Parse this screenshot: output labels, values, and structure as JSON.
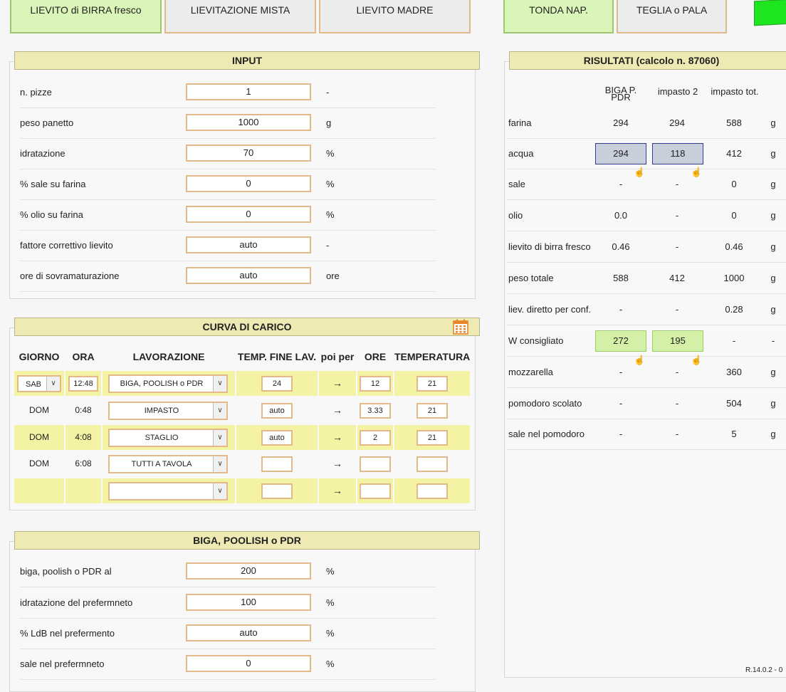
{
  "tabs": [
    "LIEVITO di BIRRA fresco",
    "LIEVITAZIONE MISTA",
    "LIEVITO MADRE",
    "TONDA NAP.",
    "TEGLIA o PALA"
  ],
  "input": {
    "title": "INPUT",
    "rows": [
      {
        "label": "n. pizze",
        "value": "1",
        "unit": "-"
      },
      {
        "label": "peso panetto",
        "value": "1000",
        "unit": "g"
      },
      {
        "label": "idratazione",
        "value": "70",
        "unit": "%"
      },
      {
        "label": "% sale su farina",
        "value": "0",
        "unit": "%"
      },
      {
        "label": "% olio su farina",
        "value": "0",
        "unit": "%"
      },
      {
        "label": "fattore correttivo lievito",
        "value": "auto",
        "unit": "-"
      },
      {
        "label": "ore di sovramaturazione",
        "value": "auto",
        "unit": "ore"
      }
    ]
  },
  "curva": {
    "title": "CURVA DI CARICO",
    "headers": [
      "GIORNO",
      "ORA",
      "LAVORAZIONE",
      "TEMP. FINE LAV.",
      "poi per",
      "ORE",
      "TEMPERATURA"
    ],
    "rows": [
      {
        "giorno": "SAB",
        "ora": "12:48",
        "lav": "BIGA, POOLISH o PDR",
        "temp": "24",
        "arrow": "→",
        "ore": "12",
        "temperatura": "21"
      },
      {
        "giorno": "DOM",
        "ora": "0:48",
        "lav": "IMPASTO",
        "temp": "auto",
        "arrow": "→",
        "ore": "3.33",
        "temperatura": "21"
      },
      {
        "giorno": "DOM",
        "ora": "4:08",
        "lav": "STAGLIO",
        "temp": "auto",
        "arrow": "→",
        "ore": "2",
        "temperatura": "21"
      },
      {
        "giorno": "DOM",
        "ora": "6:08",
        "lav": "TUTTI A TAVOLA",
        "temp": "",
        "arrow": "→",
        "ore": "",
        "temperatura": ""
      },
      {
        "giorno": "",
        "ora": "",
        "lav": "",
        "temp": "",
        "arrow": "→",
        "ore": "",
        "temperatura": ""
      }
    ]
  },
  "biga": {
    "title": "BIGA, POOLISH o PDR",
    "rows": [
      {
        "label": "biga, poolish o PDR al",
        "value": "200",
        "unit": "%"
      },
      {
        "label": "idratazione del prefermneto",
        "value": "100",
        "unit": "%"
      },
      {
        "label": "% LdB nel prefermento",
        "value": "auto",
        "unit": "%"
      },
      {
        "label": "sale nel prefermneto",
        "value": "0",
        "unit": "%"
      }
    ]
  },
  "risultati": {
    "title": "RISULTATI (calcolo n. 87060)",
    "col_headers": [
      "BIGA P. PDR",
      "impasto 2",
      "impasto tot."
    ],
    "rows": [
      {
        "label": "farina",
        "c1": "294",
        "c2": "294",
        "c3": "588",
        "unit": "g"
      },
      {
        "label": "acqua",
        "c1": "294",
        "c2": "118",
        "c3": "412",
        "unit": "g"
      },
      {
        "label": "sale",
        "c1": "-",
        "c2": "-",
        "c3": "0",
        "unit": "g"
      },
      {
        "label": "olio",
        "c1": "0.0",
        "c2": "-",
        "c3": "0",
        "unit": "g"
      },
      {
        "label": "lievito di birra fresco",
        "c1": "0.46",
        "c2": "-",
        "c3": "0.46",
        "unit": "g"
      },
      {
        "label": "peso totale",
        "c1": "588",
        "c2": "412",
        "c3": "1000",
        "unit": "g"
      },
      {
        "label": "liev. diretto per conf.",
        "c1": "-",
        "c2": "-",
        "c3": "0.28",
        "unit": "g"
      },
      {
        "label": "W consigliato",
        "c1": "272",
        "c2": "195",
        "c3": "-",
        "unit": "-"
      },
      {
        "label": "mozzarella",
        "c1": "-",
        "c2": "-",
        "c3": "360",
        "unit": "g"
      },
      {
        "label": "pomodoro scolato",
        "c1": "-",
        "c2": "-",
        "c3": "504",
        "unit": "g"
      },
      {
        "label": "sale nel pomodoro",
        "c1": "-",
        "c2": "-",
        "c3": "5",
        "unit": "g"
      }
    ]
  },
  "version": "R.14.0.2 - 0"
}
